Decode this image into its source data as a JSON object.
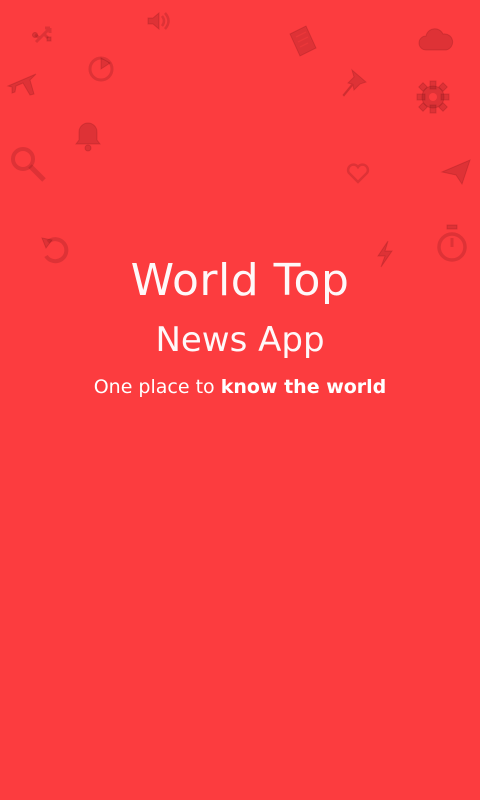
{
  "splash": {
    "title_line1": "World Top",
    "title_line2": "News App",
    "tagline_plain": "One place to ",
    "tagline_bold": "know the world"
  },
  "colors": {
    "background": "#fc3c3f",
    "text": "#ffffff",
    "pattern": "#8a1a1f"
  },
  "pattern_icons": [
    "usb-icon",
    "volume-icon",
    "note-icon",
    "cloud-icon",
    "airplane-icon",
    "refresh-icon",
    "pin-icon",
    "gear-icon",
    "bell-icon",
    "search-icon",
    "heart-icon",
    "send-icon",
    "undo-icon",
    "bolt-icon",
    "stopwatch-icon"
  ]
}
